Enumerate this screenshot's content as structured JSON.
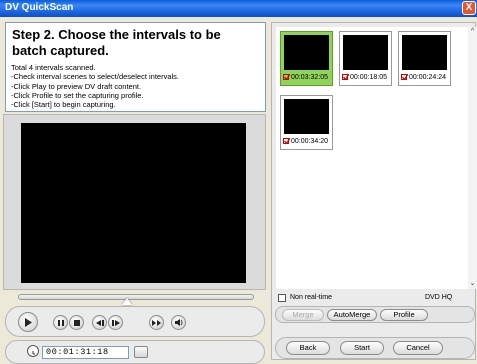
{
  "window": {
    "title": "DV QuickScan",
    "close_glyph": "X"
  },
  "instructions": {
    "heading": "Step 2. Choose the intervals to be batch captured.",
    "lines": [
      "Total 4 intervals scanned.",
      "-Check interval scenes to select/deselect intervals.",
      "-Click Play to preview DV draft content.",
      "-Click Profile to set the capturing profile.",
      "-Click [Start] to begin capturing."
    ]
  },
  "intervals": [
    {
      "time": "00:03:32:05",
      "checked": true,
      "selected": true
    },
    {
      "time": "00:00:18:05",
      "checked": true,
      "selected": false
    },
    {
      "time": "00:00:24:24",
      "checked": true,
      "selected": false
    },
    {
      "time": "00:00:34:20",
      "checked": true,
      "selected": false
    }
  ],
  "player": {
    "timecode": "00:01:31:18",
    "icons": [
      "play-icon",
      "pause-icon",
      "stop-icon",
      "step-back-icon",
      "step-forward-icon",
      "fast-forward-icon",
      "volume-icon"
    ]
  },
  "options": {
    "non_realtime_label": "Non real-time",
    "non_realtime_checked": false,
    "profile_label": "DVD HQ"
  },
  "buttons": {
    "merge": "Merge",
    "automerge": "AutoMerge",
    "profile": "Profile",
    "back": "Back",
    "start": "Start",
    "cancel": "Cancel"
  },
  "colors": {
    "title_bar": "#0a5ddf",
    "selected_thumb": "#8fd35a",
    "checkbox_red": "#cc0000"
  }
}
